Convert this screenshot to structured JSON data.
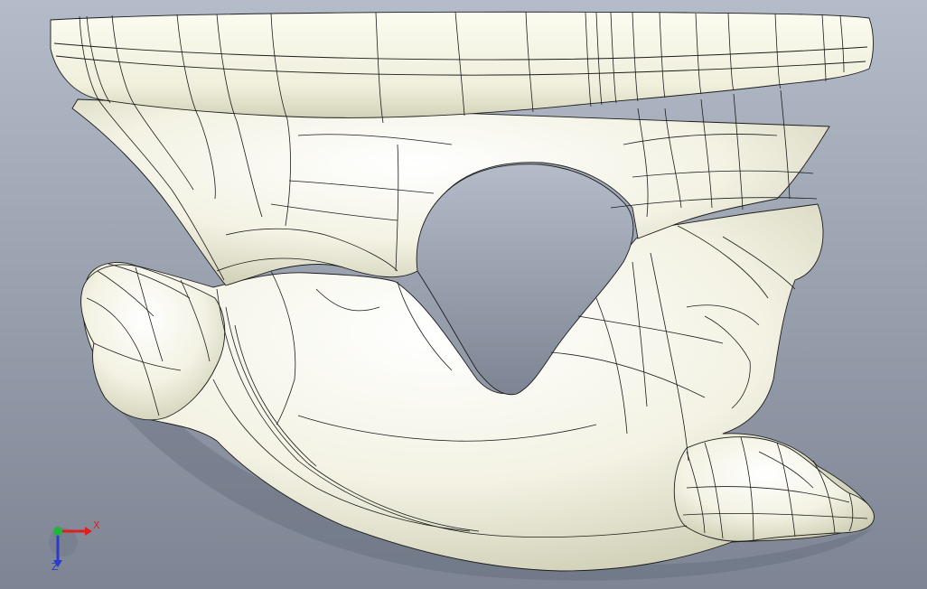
{
  "viewport": {
    "background_top": "#b4bcc9",
    "background_bottom": "#7d8594",
    "model": {
      "fill": "#f3f2e3",
      "highlight": "#ffffff",
      "shadow": "#c9c9ae",
      "edge_color": "#1c1c1c"
    }
  },
  "triad": {
    "x_label": "X",
    "z_label": "Z",
    "x_color": "#e01e1e",
    "y_color": "#22b53a",
    "z_color": "#2a3cc8"
  }
}
